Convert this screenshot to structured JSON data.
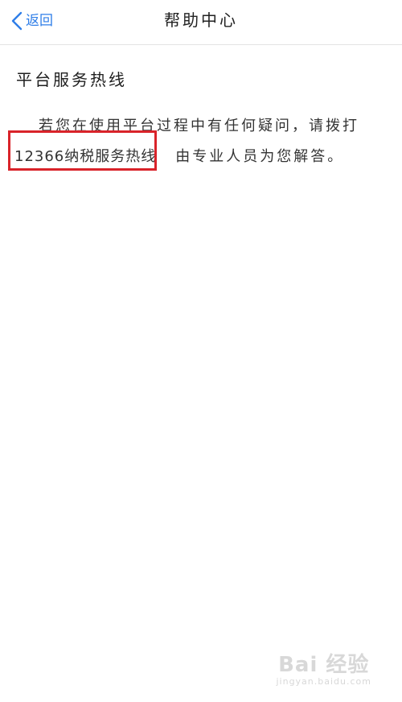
{
  "nav": {
    "back_label": "返回",
    "title": "帮助中心"
  },
  "section": {
    "title": "平台服务热线",
    "line1": "若您在使用平台过程中有任何疑问，请拨打",
    "hotline": "12366纳税服务热线",
    "line2_rest": "由专业人员为您解答。"
  },
  "watermark": {
    "main": "Bai 经验",
    "sub": "jingyan.baidu.com"
  },
  "colors": {
    "accent": "#2f7ee8",
    "highlight_box": "#d9232a"
  }
}
